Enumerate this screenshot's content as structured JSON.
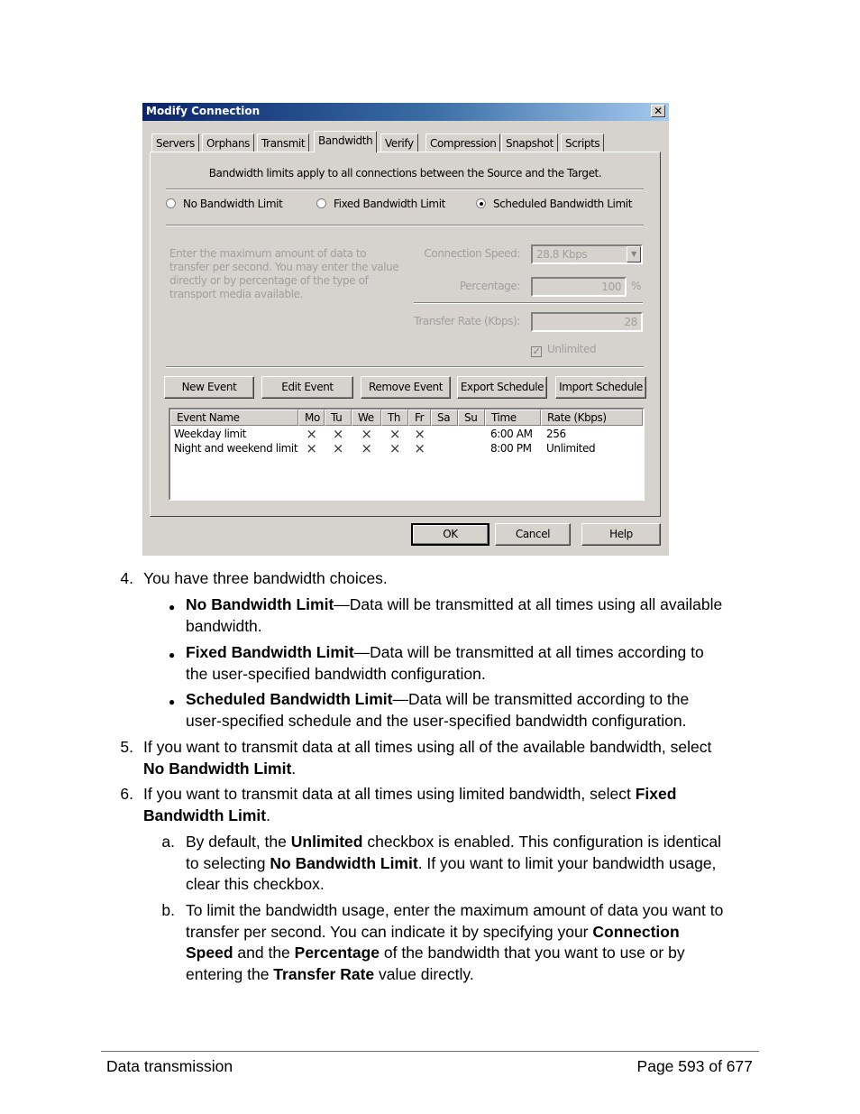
{
  "dialog": {
    "title": "Modify Connection",
    "close_icon": "close-icon",
    "tabs": [
      {
        "label": "Servers",
        "active": false
      },
      {
        "label": "Orphans",
        "active": false
      },
      {
        "label": "Transmit",
        "active": false
      },
      {
        "label": "Bandwidth",
        "active": true
      },
      {
        "label": "Verify",
        "active": false
      },
      {
        "label": "Compression",
        "active": false
      },
      {
        "label": "Snapshot",
        "active": false
      },
      {
        "label": "Scripts",
        "active": false
      }
    ],
    "notice": "Bandwidth limits apply to all connections between the Source and the Target.",
    "radios": [
      {
        "label": "No Bandwidth Limit",
        "selected": false
      },
      {
        "label": "Fixed Bandwidth Limit",
        "selected": false
      },
      {
        "label": "Scheduled Bandwidth Limit",
        "selected": true
      }
    ],
    "help_text": "Enter the maximum amount of data to transfer per second.  You may enter the value directly or by percentage of the type of transport media available.",
    "connection_speed": {
      "label": "Connection Speed:",
      "value": "28.8 Kbps"
    },
    "percentage": {
      "label": "Percentage:",
      "value": "100",
      "unit": "%"
    },
    "transfer_rate": {
      "label": "Transfer Rate (Kbps):",
      "value": "28"
    },
    "unlimited": {
      "label": "Unlimited",
      "checked": true
    },
    "buttons": {
      "new_event": "New Event",
      "edit_event": "Edit Event",
      "remove_event": "Remove Event",
      "export_schedule": "Export Schedule",
      "import_schedule": "Import Schedule"
    },
    "schedule": {
      "columns": [
        "Event Name",
        "Mo",
        "Tu",
        "We",
        "Th",
        "Fr",
        "Sa",
        "Su",
        "Time",
        "Rate (Kbps)"
      ],
      "rows": [
        {
          "name": "Weekday limit",
          "mo": "X",
          "tu": "X",
          "we": "X",
          "th": "X",
          "fr": "X",
          "sa": "",
          "su": "",
          "time": "6:00 AM",
          "rate": "256"
        },
        {
          "name": "Night and weekend limit",
          "mo": "X",
          "tu": "X",
          "we": "X",
          "th": "X",
          "fr": "X",
          "sa": "",
          "su": "",
          "time": "8:00 PM",
          "rate": "Unlimited"
        }
      ]
    },
    "footer_buttons": {
      "ok": "OK",
      "cancel": "Cancel",
      "help": "Help"
    }
  },
  "document": {
    "step4": {
      "num": "4.",
      "text": "You have three bandwidth choices."
    },
    "bullets": [
      {
        "bold": "No Bandwidth Limit",
        "line1": "—Data will be transmitted at all times using all available",
        "line2": "bandwidth."
      },
      {
        "bold": "Fixed Bandwidth Limit",
        "line1": "—Data will be transmitted at all times according to",
        "line2": "the user-specified bandwidth configuration."
      },
      {
        "bold": "Scheduled Bandwidth Limit",
        "line1": "—Data will be transmitted according to the",
        "line2": "user-specified schedule and the user-specified bandwidth configuration."
      }
    ],
    "step5": {
      "num": "5.",
      "line1": "If you want to transmit data at all times using all of the available bandwidth, select",
      "bold": "No Bandwidth Limit",
      "tail": "."
    },
    "step6": {
      "num": "6.",
      "line1": "If you want to transmit data at all times using limited bandwidth, select ",
      "bold1": "Fixed",
      "bold2": "Bandwidth Limit",
      "tail": "."
    },
    "sub_a": {
      "num": "a.",
      "t1": "By default, the ",
      "b1": "Unlimited",
      "t2": " checkbox is enabled. This configuration is identical",
      "t3": "to selecting ",
      "b2": "No Bandwidth Limit",
      "t4": ". If you want to limit your bandwidth usage,",
      "t5": "clear this checkbox."
    },
    "sub_b": {
      "num": "b.",
      "t1": "To limit the bandwidth usage, enter the maximum amount of data you want to",
      "t2": "transfer per second. You can indicate it by specifying your ",
      "b1": "Connection",
      "b2": "Speed",
      "t3": " and the ",
      "b3": "Percentage",
      "t4": " of the bandwidth that you want to use or by",
      "t5": "entering the ",
      "b4": "Transfer Rate",
      "t6": " value directly."
    }
  },
  "footer": {
    "section": "Data transmission",
    "page": "Page 593 of 677"
  }
}
